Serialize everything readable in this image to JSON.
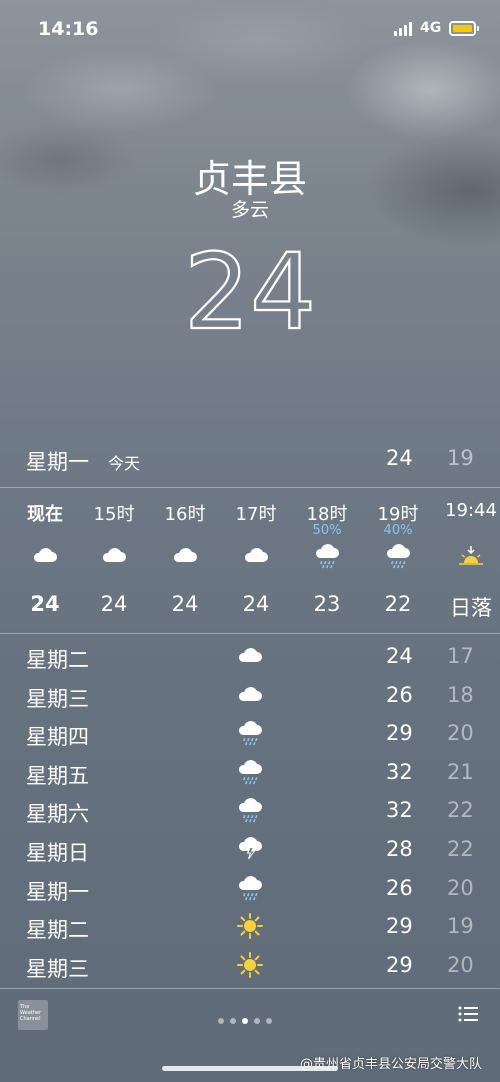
{
  "status_bar": {
    "time": "14:16",
    "network": "4G",
    "battery_color": "#f4c81b"
  },
  "location": {
    "city": "贞丰县",
    "condition": "多云",
    "temperature": "24"
  },
  "today": {
    "day": "星期一",
    "tag": "今天",
    "high": "24",
    "low": "19"
  },
  "hourly": [
    {
      "label": "现在",
      "icon": "cloud-icon",
      "precip": "",
      "temp": "24"
    },
    {
      "label": "15时",
      "icon": "cloud-icon",
      "precip": "",
      "temp": "24"
    },
    {
      "label": "16时",
      "icon": "cloud-icon",
      "precip": "",
      "temp": "24"
    },
    {
      "label": "17时",
      "icon": "cloud-icon",
      "precip": "",
      "temp": "24"
    },
    {
      "label": "18时",
      "icon": "rain-cloud-icon",
      "precip": "50%",
      "temp": "23"
    },
    {
      "label": "19时",
      "icon": "rain-cloud-icon",
      "precip": "40%",
      "temp": "22"
    },
    {
      "label": "19:44",
      "icon": "sunset-icon",
      "precip": "",
      "temp": "日落"
    }
  ],
  "daily": [
    {
      "day": "星期二",
      "icon": "cloud-icon",
      "high": "24",
      "low": "17"
    },
    {
      "day": "星期三",
      "icon": "cloud-icon",
      "high": "26",
      "low": "18"
    },
    {
      "day": "星期四",
      "icon": "rain-cloud-icon",
      "high": "29",
      "low": "20"
    },
    {
      "day": "星期五",
      "icon": "rain-cloud-icon",
      "high": "32",
      "low": "21"
    },
    {
      "day": "星期六",
      "icon": "rain-cloud-icon",
      "high": "32",
      "low": "22"
    },
    {
      "day": "星期日",
      "icon": "thunderstorm-icon",
      "high": "28",
      "low": "22"
    },
    {
      "day": "星期一",
      "icon": "rain-cloud-icon",
      "high": "26",
      "low": "20"
    },
    {
      "day": "星期二",
      "icon": "sun-icon",
      "high": "29",
      "low": "19"
    },
    {
      "day": "星期三",
      "icon": "sun-icon",
      "high": "29",
      "low": "20"
    }
  ],
  "footer": {
    "logo_text": "The Weather Channel",
    "page_count": 5,
    "active_page": 3,
    "watermark": "@贵州省贞丰县公安局交警大队"
  }
}
